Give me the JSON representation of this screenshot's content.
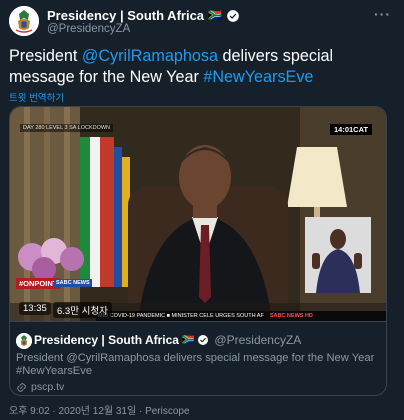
{
  "tweet": {
    "author_name": "Presidency | South Africa",
    "author_flag": "🇿🇦",
    "handle": "@PresidencyZA",
    "more_icon": "more-icon",
    "text_prefix": "President ",
    "mention": "@CyrilRamaphosa",
    "text_middle": " delivers special message for the New Year ",
    "hashtag": "#NewYearsEve",
    "translate_label": "트윗 번역하기"
  },
  "video": {
    "lockdown_text": "DAY 280 LEVEL 3 SA LOCKDOWN",
    "clock_text": "14:01CAT",
    "onpoint_text": "#ONPOINT",
    "channel_text": "SABC NEWS",
    "ticker_text": "MID COVID-19 PANDEMIC  ■  MINISTER CELE URGES SOUTH AF",
    "ticker_news": "SABC NEWS HD",
    "timestamp": "13:35",
    "viewers": "6.3만 시청자"
  },
  "card": {
    "author_name": "Presidency | South Africa",
    "author_flag": "🇿🇦",
    "handle": "@PresidencyZA",
    "text": "President @CyrilRamaphosa delivers special message for the New Year #NewYearsEve",
    "link_icon": "link-icon",
    "link_text": "pscp.tv"
  },
  "footer": {
    "meta": "오후 9:02 · 2020년 12월 31일 · Periscope"
  },
  "colors": {
    "background": "#15202b",
    "accent": "#1d9bf0",
    "secondary_text": "#8b98a5",
    "border": "#38444d"
  }
}
